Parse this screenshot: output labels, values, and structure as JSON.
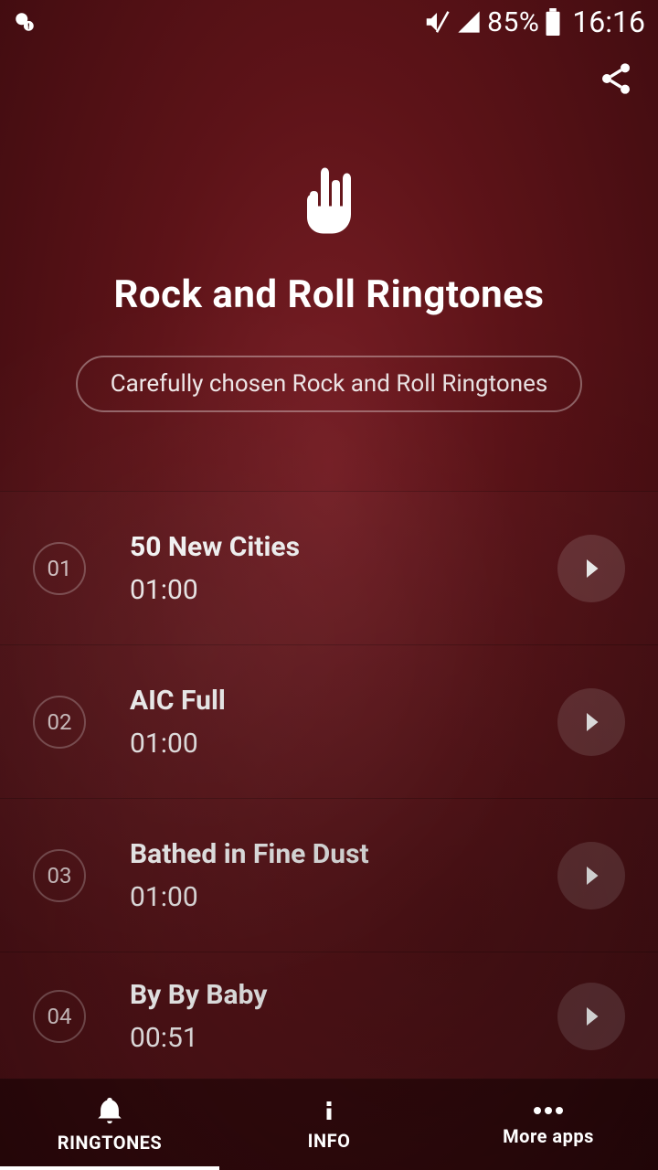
{
  "status": {
    "battery_pct": "85%",
    "time": "16:16"
  },
  "header": {
    "title": "Rock and Roll Ringtones",
    "subtitle": "Carefully chosen Rock and Roll Ringtones"
  },
  "tracks": [
    {
      "index": "01",
      "title": "50 New Cities",
      "duration": "01:00"
    },
    {
      "index": "02",
      "title": "AIC Full",
      "duration": "01:00"
    },
    {
      "index": "03",
      "title": "Bathed in Fine Dust",
      "duration": "01:00"
    },
    {
      "index": "04",
      "title": "By By Baby",
      "duration": "00:51"
    }
  ],
  "nav": {
    "ringtones": "RINGTONES",
    "info": "INFO",
    "more": "More apps"
  }
}
